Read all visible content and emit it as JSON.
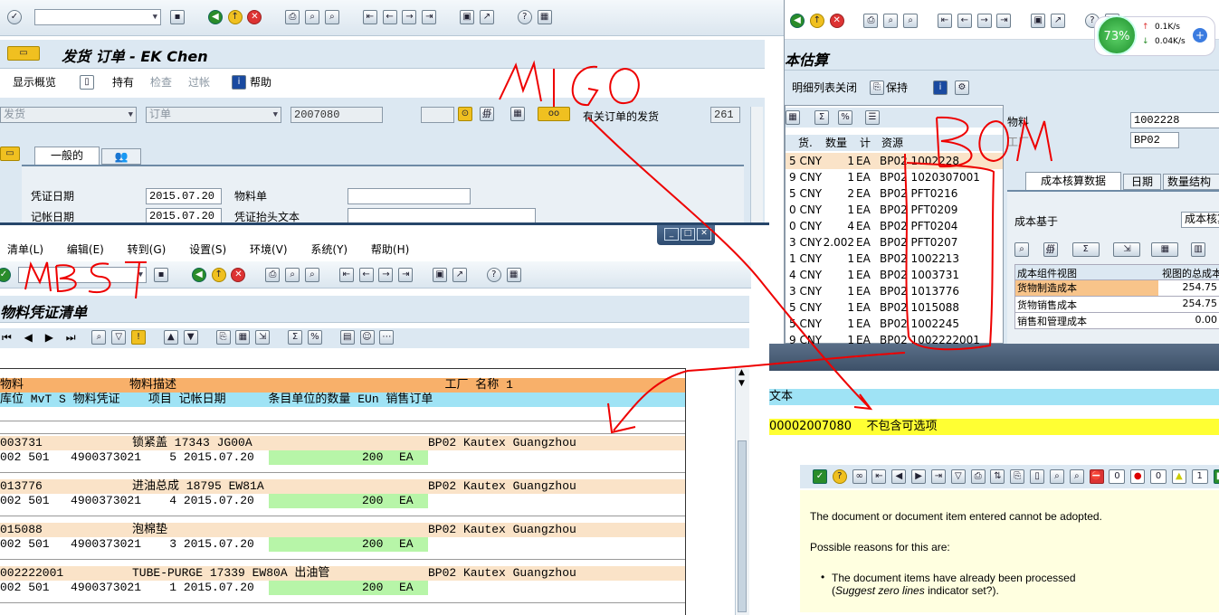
{
  "top_toolbar": {
    "command_field": ""
  },
  "migo": {
    "title": "发货 订单 - EK Chen",
    "app_toolbar": [
      "显示概览",
      "持有",
      "检查",
      "过帐",
      "帮助"
    ],
    "action": "发货",
    "reference": "订单",
    "order_number": "2007080",
    "movement_type": "261",
    "ref_text": "有关订单的发货",
    "tabs": [
      "一般的"
    ],
    "labels": {
      "doc_date": "凭证日期",
      "post_date": "记帐日期",
      "material_slip": "物料单",
      "header_text": "凭证抬头文本"
    },
    "values": {
      "doc_date": "2015.07.20",
      "post_date": "2015.07.20"
    }
  },
  "mb51": {
    "menu": [
      "清单(L)",
      "编辑(E)",
      "转到(G)",
      "设置(S)",
      "环境(V)",
      "系统(Y)",
      "帮助(H)"
    ],
    "title": "物料凭证清单",
    "header1": "物料               物料描述                                      工厂 名称 1",
    "header2": "库位 MvT S 物料凭证    项目 记帐日期      条目单位的数量 EUn 销售订单",
    "records": [
      {
        "mat": "003731",
        "desc": "锁紧盖 17343 JG00A",
        "plant": "BP02 Kautex Guangzhou",
        "line": "002 501   4900373021    5 2015.07.20",
        "qty": "200",
        "unit": "EA"
      },
      {
        "mat": "013776",
        "desc": "进油总成 18795 EW81A",
        "plant": "BP02 Kautex Guangzhou",
        "line": "002 501   4900373021    4 2015.07.20",
        "qty": "200",
        "unit": "EA"
      },
      {
        "mat": "015088",
        "desc": "泡棉垫",
        "plant": "BP02 Kautex Guangzhou",
        "line": "002 501   4900373021    3 2015.07.20",
        "qty": "200",
        "unit": "EA"
      },
      {
        "mat": "002222001",
        "desc": "TUBE-PURGE 17339 EW80A 出油管",
        "plant": "BP02 Kautex Guangzhou",
        "line": "002 501   4900373021    1 2015.07.20",
        "qty": "200",
        "unit": "EA"
      }
    ]
  },
  "cost": {
    "title": "本估算",
    "toolbar": [
      "明细列表关闭",
      "保持"
    ],
    "cols": [
      "货.",
      "数量",
      "计",
      "资源"
    ],
    "rows": [
      [
        "5 CNY",
        "1",
        "EA",
        "BP02 1002228"
      ],
      [
        "9 CNY",
        "1",
        "EA",
        "BP02 1020307001"
      ],
      [
        "5 CNY",
        "2",
        "EA",
        "BP02 PFT0216"
      ],
      [
        "0 CNY",
        "1",
        "EA",
        "BP02 PFT0209"
      ],
      [
        "0 CNY",
        "4",
        "EA",
        "BP02 PFT0204"
      ],
      [
        "3 CNY",
        "2.002",
        "EA",
        "BP02 PFT0207"
      ],
      [
        "1 CNY",
        "1",
        "EA",
        "BP02 1002213"
      ],
      [
        "4 CNY",
        "1",
        "EA",
        "BP02 1003731"
      ],
      [
        "3 CNY",
        "1",
        "EA",
        "BP02 1013776"
      ],
      [
        "5 CNY",
        "1",
        "EA",
        "BP02 1015088"
      ],
      [
        "5 CNY",
        "1",
        "EA",
        "BP02 1002245"
      ],
      [
        "9 CNY",
        "1",
        "EA",
        "BP02 1002222001"
      ]
    ],
    "material_label": "物料",
    "material_value": "1002228",
    "plant_label": "工厂",
    "plant_value": "BP02",
    "tabs": [
      "成本核算数据",
      "日期",
      "数量结构"
    ],
    "base_label": "成本基于",
    "base_value": "成本核算",
    "comp_header": [
      "成本组件视图",
      "视图的总成本"
    ],
    "comp_rows": [
      [
        "货物制造成本",
        "254.75"
      ],
      [
        "货物销售成本",
        "254.75"
      ],
      [
        "销售和管理成本",
        "0.00"
      ]
    ]
  },
  "msg": {
    "header": "文本",
    "yellow_text": "00002007080    不包含可选项",
    "counts": [
      "0",
      "0",
      "1"
    ],
    "line1": "The document or document item entered cannot be adopted.",
    "line2": "Possible reasons for this are:",
    "bullet": "The document items have already been processed",
    "bullet2": "(Suggest zero lines indicator set?).",
    "bullet2_italic": "Suggest zero lines"
  },
  "net": {
    "cpu": "73%",
    "up": "0.1K/s",
    "down": "0.04K/s"
  },
  "annotations": [
    "MIGO",
    "BOM",
    "MB51"
  ],
  "colors": {
    "orange": "#f8b06a",
    "peach": "#fae3c8",
    "cyan": "#9fe3f5",
    "green": "#b7f5a8",
    "yellow": "#ffff33",
    "sapblue": "#dce8f2"
  }
}
